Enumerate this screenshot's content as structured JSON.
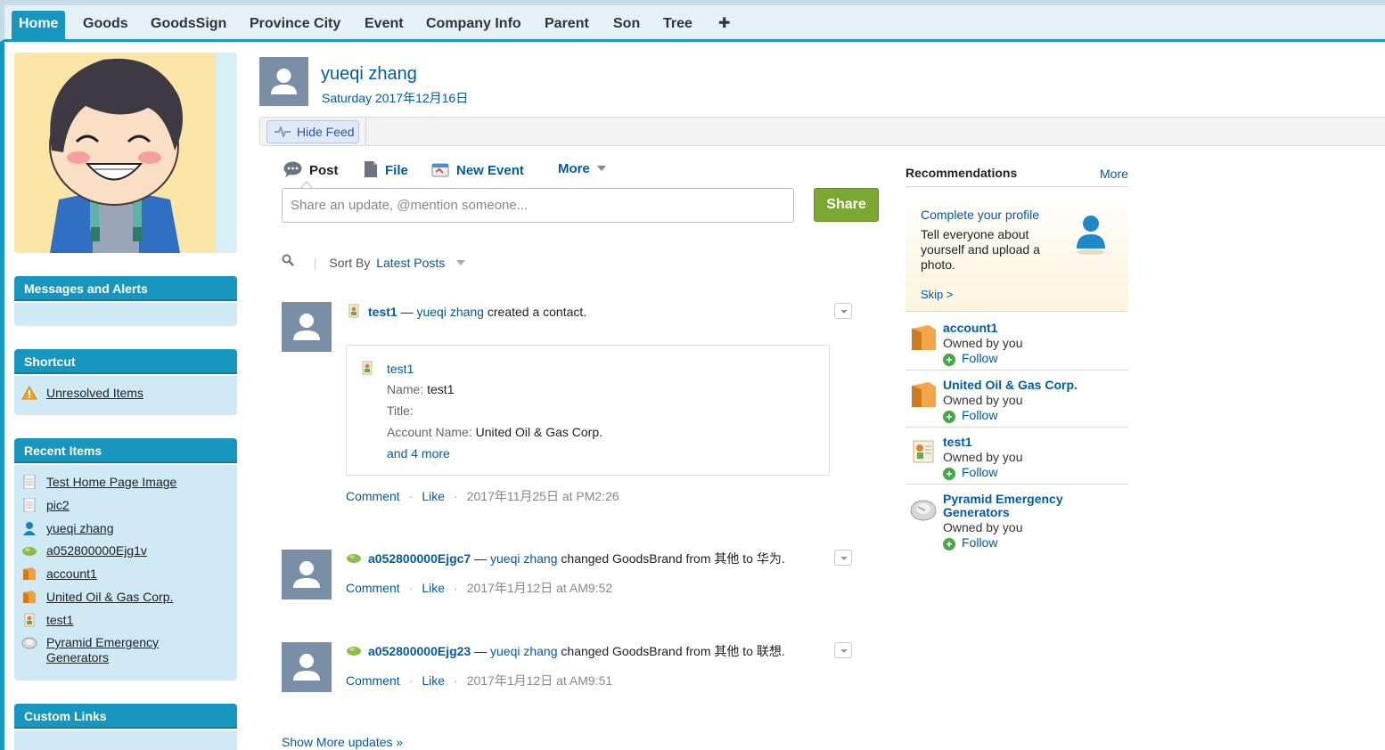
{
  "tabs": [
    {
      "label": "Home",
      "active": true
    },
    {
      "label": "Goods"
    },
    {
      "label": "GoodsSign"
    },
    {
      "label": "Province City"
    },
    {
      "label": "Event"
    },
    {
      "label": "Company Info"
    },
    {
      "label": "Parent"
    },
    {
      "label": "Son"
    },
    {
      "label": "Tree"
    },
    {
      "label": "✚"
    }
  ],
  "sidebar": {
    "messages_title": "Messages and Alerts",
    "shortcut_title": "Shortcut",
    "shortcut_items": [
      {
        "label": "Unresolved Items",
        "icon": "warning-icon"
      }
    ],
    "recent_title": "Recent Items",
    "recent_items": [
      {
        "label": "Test Home Page Image",
        "icon": "document-icon"
      },
      {
        "label": "pic2",
        "icon": "document-icon"
      },
      {
        "label": "yueqi zhang",
        "icon": "user-icon"
      },
      {
        "label": "a052800000Ejg1v",
        "icon": "goods-icon"
      },
      {
        "label": "account1",
        "icon": "folder-icon"
      },
      {
        "label": "United Oil & Gas Corp.",
        "icon": "folder-icon"
      },
      {
        "label": "test1",
        "icon": "contact-icon"
      },
      {
        "label": "Pyramid Emergency",
        "label2": "Generators",
        "icon": "asset-icon"
      }
    ],
    "custom_links_title": "Custom Links"
  },
  "profile": {
    "name": "yueqi zhang",
    "date": "Saturday 2017年12月16日"
  },
  "feedbar": {
    "hide_feed": "Hide Feed"
  },
  "publisher": {
    "post": "Post",
    "file": "File",
    "new_event": "New Event",
    "more": "More",
    "placeholder": "Share an update, @mention someone...",
    "share": "Share"
  },
  "sort": {
    "label": "Sort By",
    "value": "Latest Posts"
  },
  "feed": [
    {
      "record": "test1",
      "dash": "—",
      "user": "yueqi zhang",
      "action": "created a contact.",
      "card": {
        "record": "test1",
        "name_label": "Name:",
        "name_value": "test1",
        "title_label": "Title:",
        "account_label": "Account Name:",
        "account_value": "United Oil & Gas Corp.",
        "more": "and 4 more"
      },
      "comment": "Comment",
      "like": "Like",
      "time": "2017年11月25日 at PM2:26"
    },
    {
      "record": "a052800000Ejgc7",
      "dash": "—",
      "user": "yueqi zhang",
      "action": "changed GoodsBrand from 其他 to 华为.",
      "comment": "Comment",
      "like": "Like",
      "time": "2017年1月12日 at AM9:52"
    },
    {
      "record": "a052800000Ejg23",
      "dash": "—",
      "user": "yueqi zhang",
      "action": "changed GoodsBrand from 其他 to 联想.",
      "comment": "Comment",
      "like": "Like",
      "time": "2017年1月12日 at AM9:51"
    }
  ],
  "show_more": "Show More updates »",
  "recommendations": {
    "title": "Recommendations",
    "more": "More",
    "profile_card": {
      "title": "Complete your profile",
      "text": "Tell everyone about yourself and upload a photo.",
      "skip": "Skip >"
    },
    "items": [
      {
        "name": "account1",
        "owner": "Owned by you",
        "follow": "Follow",
        "icon": "folder-icon"
      },
      {
        "name": "United Oil & Gas Corp.",
        "owner": "Owned by you",
        "follow": "Follow",
        "icon": "folder-icon"
      },
      {
        "name": "test1",
        "owner": "Owned by you",
        "follow": "Follow",
        "icon": "contact-icon"
      },
      {
        "name": "Pyramid Emergency",
        "name2": "Generators",
        "owner": "Owned by you",
        "follow": "Follow",
        "icon": "asset-icon"
      }
    ]
  },
  "colors": {
    "accent": "#1797c0",
    "link": "#015ba7",
    "share": "#7aa833"
  }
}
